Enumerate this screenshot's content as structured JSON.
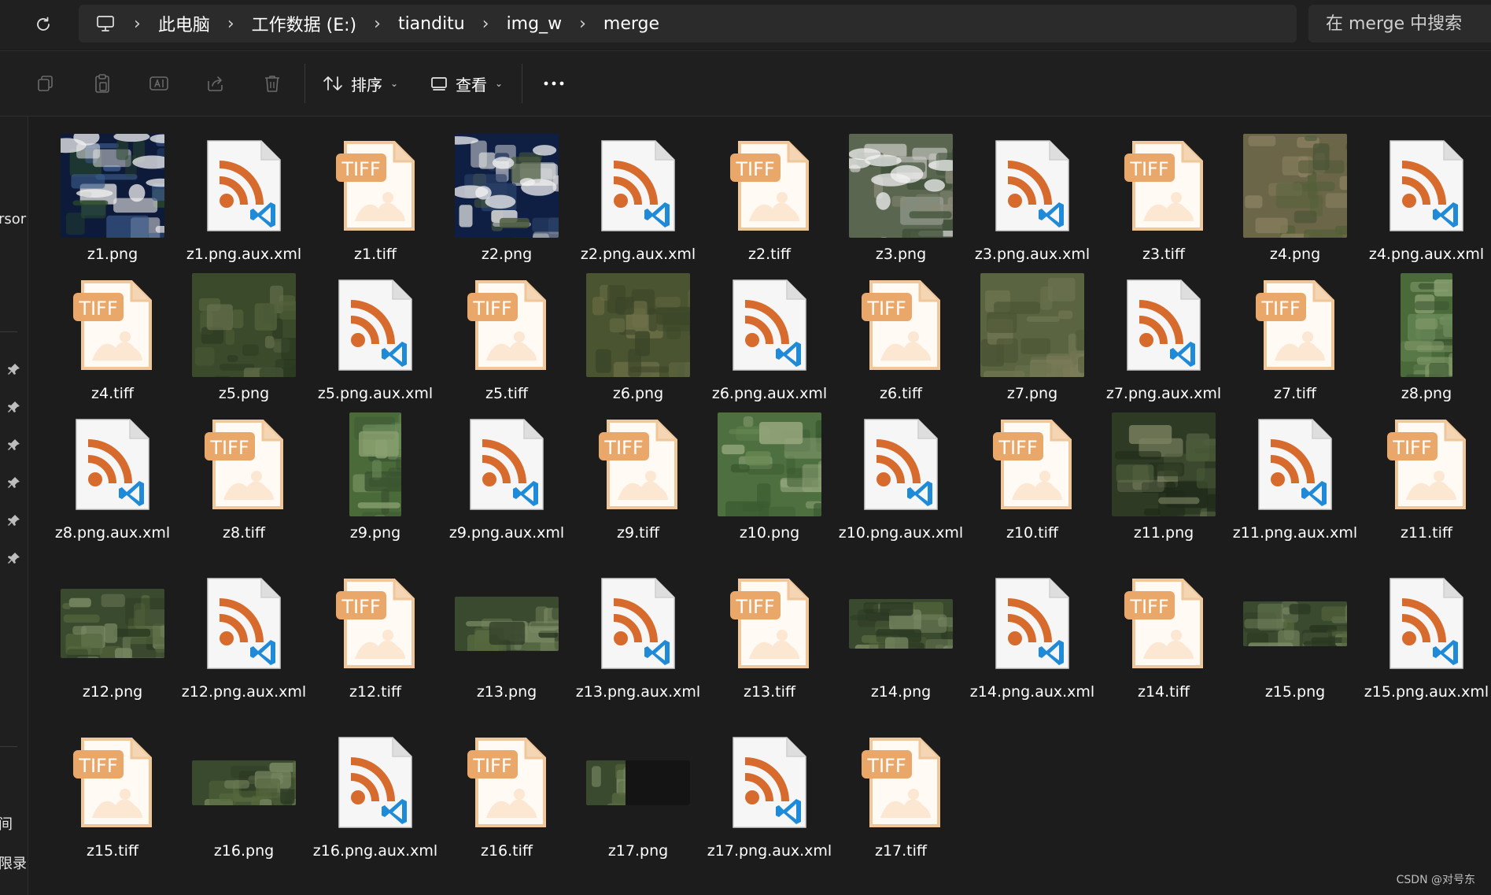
{
  "address": {
    "breadcrumbs": [
      "此电脑",
      "工作数据 (E:)",
      "tianditu",
      "img_w",
      "merge"
    ]
  },
  "search": {
    "placeholder": "在 merge 中搜索"
  },
  "toolbar": {
    "sort_label": "排序",
    "view_label": "查看"
  },
  "left_nav": {
    "fragments": [
      "rsor",
      "间",
      "限录"
    ]
  },
  "colors": {
    "xml_orange": "#d66b2d",
    "vscode_blue": "#1f8ad8",
    "tiff_badge": "#e9a76a",
    "page_white": "#f6f6f6"
  },
  "files": [
    {
      "name": "z1.png",
      "type": "png",
      "tone": "globe",
      "aspect": 1.0
    },
    {
      "name": "z1.png.aux.xml",
      "type": "xml"
    },
    {
      "name": "z1.tiff",
      "type": "tiff"
    },
    {
      "name": "z2.png",
      "type": "png",
      "tone": "globe2",
      "aspect": 1.0
    },
    {
      "name": "z2.png.aux.xml",
      "type": "xml"
    },
    {
      "name": "z2.tiff",
      "type": "tiff"
    },
    {
      "name": "z3.png",
      "type": "png",
      "tone": "snowy",
      "aspect": 1.0
    },
    {
      "name": "z3.png.aux.xml",
      "type": "xml"
    },
    {
      "name": "z3.tiff",
      "type": "tiff"
    },
    {
      "name": "z4.png",
      "type": "png",
      "tone": "brown",
      "aspect": 1.0
    },
    {
      "name": "z4.png.aux.xml",
      "type": "xml"
    },
    {
      "name": "z4.tiff",
      "type": "tiff"
    },
    {
      "name": "z5.png",
      "type": "png",
      "tone": "green",
      "aspect": 1.0
    },
    {
      "name": "z5.png.aux.xml",
      "type": "xml"
    },
    {
      "name": "z5.tiff",
      "type": "tiff"
    },
    {
      "name": "z6.png",
      "type": "png",
      "tone": "olive",
      "aspect": 1.0
    },
    {
      "name": "z6.png.aux.xml",
      "type": "xml"
    },
    {
      "name": "z6.tiff",
      "type": "tiff"
    },
    {
      "name": "z7.png",
      "type": "png",
      "tone": "olive2",
      "aspect": 1.0
    },
    {
      "name": "z7.png.aux.xml",
      "type": "xml"
    },
    {
      "name": "z7.tiff",
      "type": "tiff"
    },
    {
      "name": "z8.png",
      "type": "png",
      "tone": "green2",
      "aspect": 0.5
    },
    {
      "name": "z8.png.aux.xml",
      "type": "xml"
    },
    {
      "name": "z8.tiff",
      "type": "tiff"
    },
    {
      "name": "z9.png",
      "type": "png",
      "tone": "green2",
      "aspect": 0.5
    },
    {
      "name": "z9.png.aux.xml",
      "type": "xml"
    },
    {
      "name": "z9.tiff",
      "type": "tiff"
    },
    {
      "name": "z10.png",
      "type": "png",
      "tone": "green3",
      "aspect": 1.0
    },
    {
      "name": "z10.png.aux.xml",
      "type": "xml"
    },
    {
      "name": "z10.tiff",
      "type": "tiff"
    },
    {
      "name": "z11.png",
      "type": "png",
      "tone": "forest",
      "aspect": 1.0
    },
    {
      "name": "z11.png.aux.xml",
      "type": "xml"
    },
    {
      "name": "z11.tiff",
      "type": "tiff"
    },
    {
      "name": "z12.png",
      "type": "png",
      "tone": "forest2",
      "aspect": 1.5
    },
    {
      "name": "z12.png.aux.xml",
      "type": "xml"
    },
    {
      "name": "z12.tiff",
      "type": "tiff"
    },
    {
      "name": "z13.png",
      "type": "png",
      "tone": "forest2",
      "aspect": 1.9
    },
    {
      "name": "z13.png.aux.xml",
      "type": "xml"
    },
    {
      "name": "z13.tiff",
      "type": "tiff"
    },
    {
      "name": "z14.png",
      "type": "png",
      "tone": "forest2",
      "aspect": 2.1
    },
    {
      "name": "z14.png.aux.xml",
      "type": "xml"
    },
    {
      "name": "z14.tiff",
      "type": "tiff"
    },
    {
      "name": "z15.png",
      "type": "png",
      "tone": "forest2",
      "aspect": 2.3
    },
    {
      "name": "z15.png.aux.xml",
      "type": "xml"
    },
    {
      "name": "z15.tiff",
      "type": "tiff"
    },
    {
      "name": "z16.png",
      "type": "png",
      "tone": "forest2",
      "aspect": 2.3
    },
    {
      "name": "z16.png.aux.xml",
      "type": "xml"
    },
    {
      "name": "z16.tiff",
      "type": "tiff"
    },
    {
      "name": "z17.png",
      "type": "png",
      "tone": "partial",
      "aspect": 2.3
    },
    {
      "name": "z17.png.aux.xml",
      "type": "xml"
    },
    {
      "name": "z17.tiff",
      "type": "tiff"
    }
  ],
  "watermark": "CSDN @对号东"
}
